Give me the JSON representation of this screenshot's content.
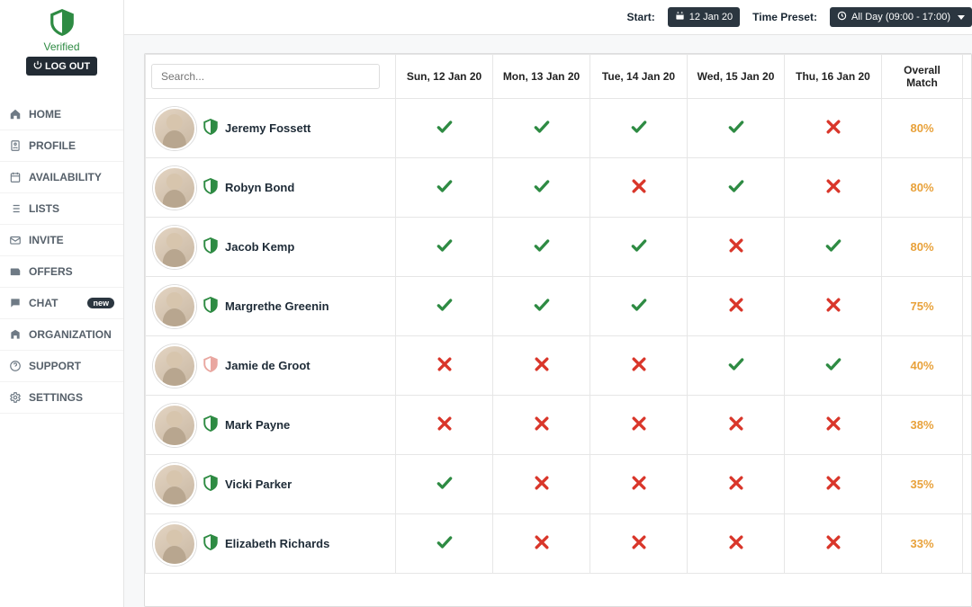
{
  "sidebar": {
    "verified_label": "Verified",
    "logout_label": "LOG OUT",
    "items": [
      {
        "icon": "home",
        "label": "HOME"
      },
      {
        "icon": "profile",
        "label": "PROFILE"
      },
      {
        "icon": "calendar",
        "label": "AVAILABILITY"
      },
      {
        "icon": "list",
        "label": "LISTS"
      },
      {
        "icon": "invite",
        "label": "INVITE"
      },
      {
        "icon": "offers",
        "label": "OFFERS"
      },
      {
        "icon": "chat",
        "label": "CHAT",
        "badge": "new"
      },
      {
        "icon": "org",
        "label": "ORGANIZATION"
      },
      {
        "icon": "support",
        "label": "SUPPORT"
      },
      {
        "icon": "settings",
        "label": "SETTINGS"
      }
    ]
  },
  "topbar": {
    "start_label": "Start:",
    "start_value": "12 Jan 20",
    "preset_label": "Time Preset:",
    "preset_value": "All Day (09:00 - 17:00)"
  },
  "table": {
    "search_placeholder": "Search...",
    "columns": [
      "Sun, 12 Jan 20",
      "Mon, 13 Jan 20",
      "Tue, 14 Jan 20",
      "Wed, 15 Jan 20",
      "Thu, 16 Jan 20"
    ],
    "overall_label": "Overall Match",
    "rows": [
      {
        "name": "Jeremy Fossett",
        "verified": true,
        "days": [
          true,
          true,
          true,
          true,
          false
        ],
        "match": "80%"
      },
      {
        "name": "Robyn Bond",
        "verified": true,
        "days": [
          true,
          true,
          false,
          true,
          false
        ],
        "match": "80%"
      },
      {
        "name": "Jacob Kemp",
        "verified": true,
        "days": [
          true,
          true,
          true,
          false,
          true
        ],
        "match": "80%"
      },
      {
        "name": "Margrethe Greenin",
        "verified": true,
        "days": [
          true,
          true,
          true,
          false,
          false
        ],
        "match": "75%"
      },
      {
        "name": "Jamie de Groot",
        "verified": false,
        "days": [
          false,
          false,
          false,
          true,
          true
        ],
        "match": "40%"
      },
      {
        "name": "Mark Payne",
        "verified": true,
        "days": [
          false,
          false,
          false,
          false,
          false
        ],
        "match": "38%"
      },
      {
        "name": "Vicki Parker",
        "verified": true,
        "days": [
          true,
          false,
          false,
          false,
          false
        ],
        "match": "35%"
      },
      {
        "name": "Elizabeth Richards",
        "verified": true,
        "days": [
          true,
          false,
          false,
          false,
          false
        ],
        "match": "33%"
      }
    ]
  }
}
